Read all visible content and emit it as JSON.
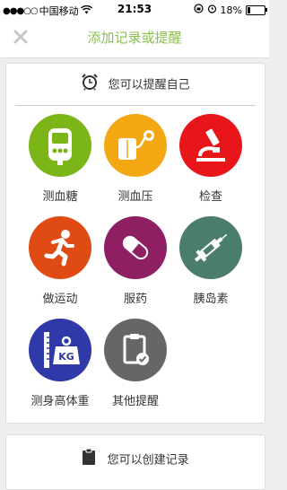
{
  "status_bar": {
    "carrier": "中国移动",
    "time": "21:53",
    "battery": "18%",
    "battery_level": 0.18
  },
  "header": {
    "title": "添加记录或提醒"
  },
  "remind_section": {
    "heading": "您可以提醒自己",
    "items": [
      {
        "label": "测血糖",
        "icon": "glucose-meter-icon",
        "color": "#7cb518"
      },
      {
        "label": "测血压",
        "icon": "blood-pressure-icon",
        "color": "#f3a712"
      },
      {
        "label": "检查",
        "icon": "microscope-icon",
        "color": "#e8151b"
      },
      {
        "label": "做运动",
        "icon": "running-icon",
        "color": "#e04a14"
      },
      {
        "label": "服药",
        "icon": "pill-icon",
        "color": "#8e1f62"
      },
      {
        "label": "胰岛素",
        "icon": "syringe-icon",
        "color": "#4a7d6e"
      },
      {
        "label": "测身高体重",
        "icon": "weight-icon",
        "color": "#2f3aa8"
      },
      {
        "label": "其他提醒",
        "icon": "clipboard-icon",
        "color": "#666666"
      }
    ]
  },
  "record_section": {
    "heading": "您可以创建记录"
  }
}
